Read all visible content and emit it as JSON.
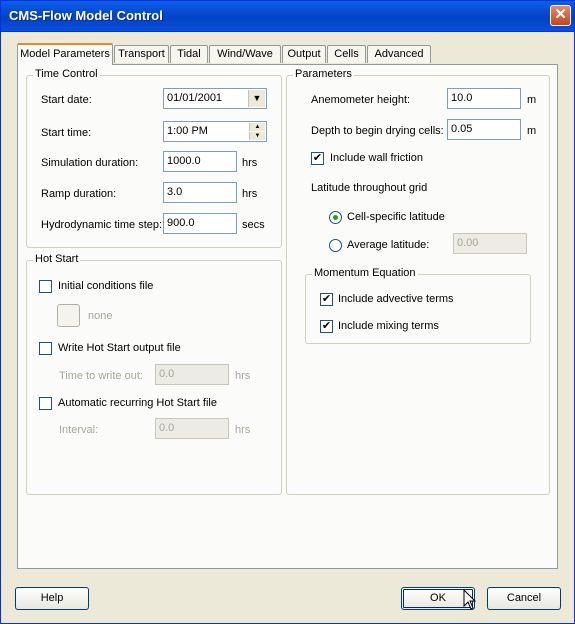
{
  "window": {
    "title": "CMS-Flow Model Control"
  },
  "tabs": [
    "Model Parameters",
    "Transport",
    "Tidal",
    "Wind/Wave",
    "Output",
    "Cells",
    "Advanced"
  ],
  "time_control": {
    "title": "Time Control",
    "start_date_label": "Start date:",
    "start_date": "01/01/2001",
    "start_time_label": "Start time:",
    "start_time": "1:00 PM",
    "sim_duration_label": "Simulation duration:",
    "sim_duration": "1000.0",
    "sim_duration_unit": "hrs",
    "ramp_label": "Ramp duration:",
    "ramp": "3.0",
    "ramp_unit": "hrs",
    "timestep_label": "Hydrodynamic time step:",
    "timestep": "900.0",
    "timestep_unit": "secs"
  },
  "hot_start": {
    "title": "Hot Start",
    "initial_conditions_label": "Initial conditions file",
    "initial_conditions_checked": false,
    "file_none": "none",
    "write_output_label": "Write Hot Start output file",
    "write_output_checked": false,
    "time_to_write_label": "Time to write out:",
    "time_to_write": "0.0",
    "time_to_write_unit": "hrs",
    "auto_recurring_label": "Automatic recurring Hot Start file",
    "auto_recurring_checked": false,
    "interval_label": "Interval:",
    "interval": "0.0",
    "interval_unit": "hrs"
  },
  "parameters": {
    "title": "Parameters",
    "anemometer_label": "Anemometer height:",
    "anemometer": "10.0",
    "anemometer_unit": "m",
    "drying_label": "Depth to begin drying cells:",
    "drying": "0.05",
    "drying_unit": "m",
    "wall_friction_label": "Include wall friction",
    "wall_friction_checked": true,
    "latitude_label": "Latitude throughout grid",
    "cell_specific_label": "Cell-specific latitude",
    "cell_specific_selected": true,
    "average_label": "Average latitude:",
    "average_value": "0.00",
    "momentum": {
      "title": "Momentum Equation",
      "advective_label": "Include advective terms",
      "advective_checked": true,
      "mixing_label": "Include mixing terms",
      "mixing_checked": true
    }
  },
  "buttons": {
    "help": "Help",
    "ok": "OK",
    "cancel": "Cancel"
  },
  "check_glyph": "✔"
}
